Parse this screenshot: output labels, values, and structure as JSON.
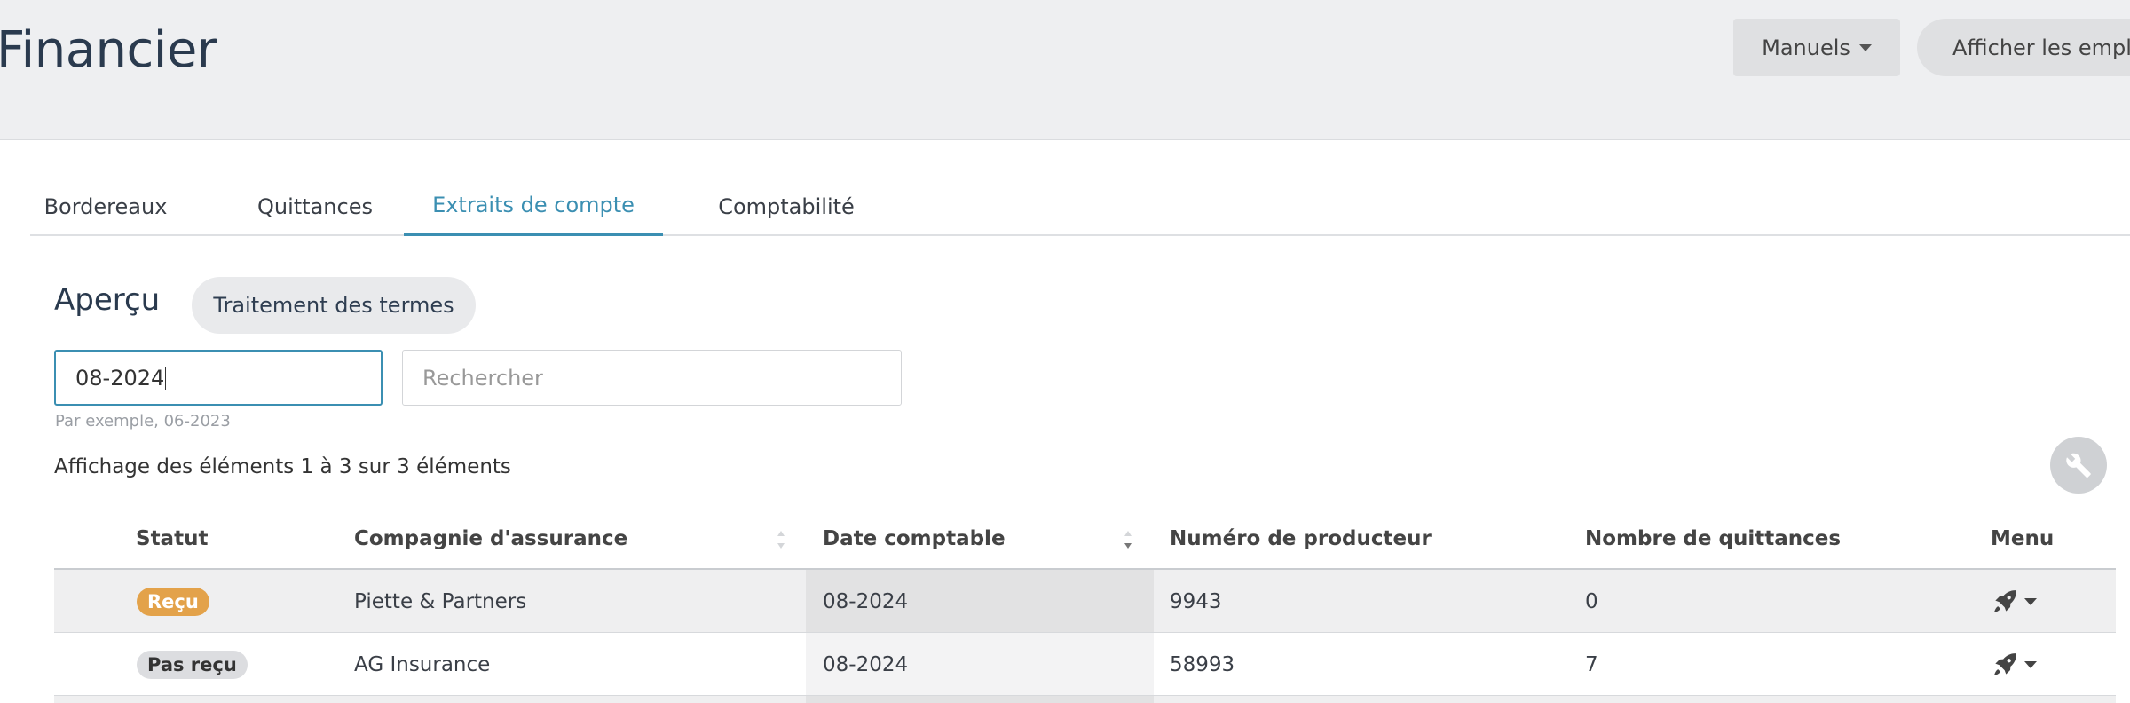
{
  "header": {
    "title": "Financier",
    "manuals_label": "Manuels",
    "jobs_label": "Afficher les emploi"
  },
  "tabs": [
    {
      "label": "Bordereaux",
      "active": false
    },
    {
      "label": "Quittances",
      "active": false
    },
    {
      "label": "Extraits de compte",
      "active": true
    },
    {
      "label": "Comptabilité",
      "active": false
    }
  ],
  "overview": {
    "title": "Aperçu",
    "terms_button": "Traitement des termes"
  },
  "filters": {
    "date_value": "08-2024",
    "date_hint": "Par exemple, 06-2023",
    "search_placeholder": "Rechercher"
  },
  "summary": "Affichage des éléments 1 à 3 sur 3 éléments",
  "table": {
    "columns": [
      "Statut",
      "Compagnie d'assurance",
      "Date comptable",
      "Numéro de producteur",
      "Nombre de quittances",
      "Menu"
    ],
    "rows": [
      {
        "status": "Reçu",
        "company": "Piette & Partners",
        "date": "08-2024",
        "producer": "9943",
        "receipts": "0"
      },
      {
        "status": "Pas reçu",
        "company": "AG Insurance",
        "date": "08-2024",
        "producer": "58993",
        "receipts": "7"
      }
    ]
  },
  "icons": {
    "wrench": "wrench-icon",
    "menu": "rocket-icon",
    "dropdown": "caret-down-icon"
  },
  "colors": {
    "accent": "#3b8fb2",
    "received_badge": "#e3a24a",
    "not_received_badge": "#dcdde0",
    "header_bg": "#eeeff1",
    "title": "#2a3a4e"
  }
}
